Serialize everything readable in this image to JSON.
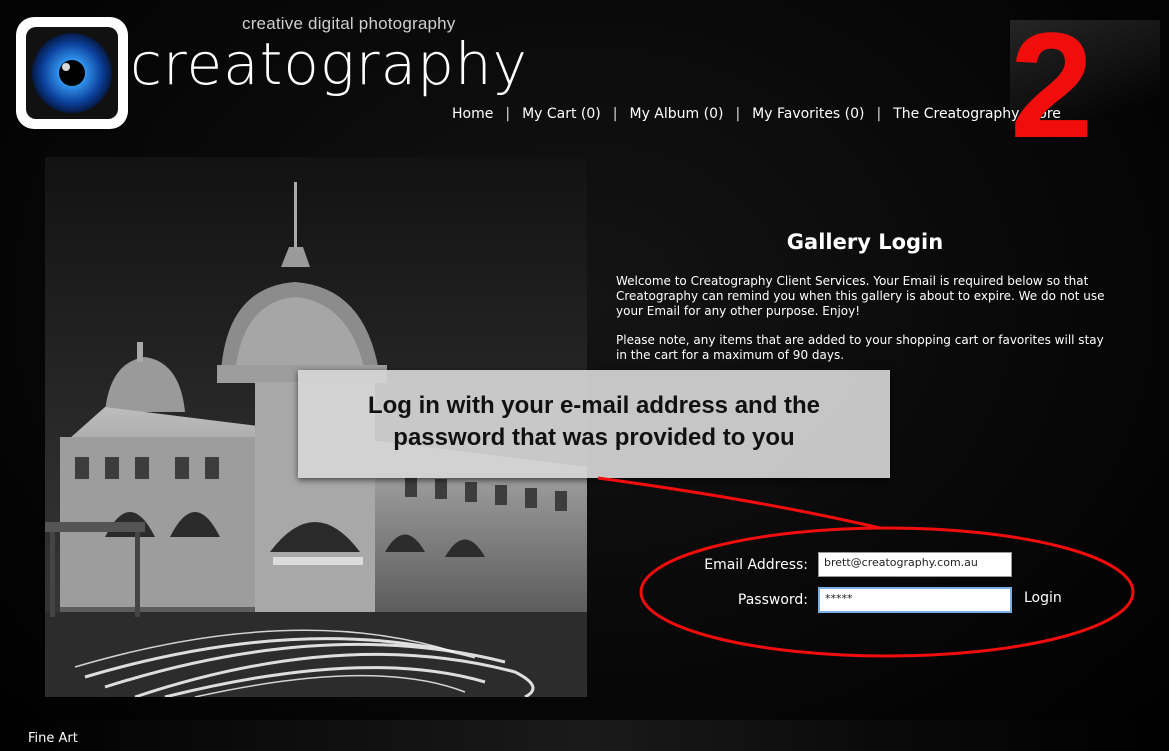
{
  "header": {
    "tagline": "creative digital photography",
    "brand": "creatography",
    "nav": [
      {
        "label": "Home"
      },
      {
        "label": "My Cart (0)"
      },
      {
        "label": "My Album (0)"
      },
      {
        "label": "My Favorites (0)"
      },
      {
        "label": "The Creatography Store"
      }
    ],
    "nav_separator": "|"
  },
  "step_marker": "2",
  "login_panel": {
    "title": "Gallery Login",
    "intro": "Welcome to Creatography Client Services. Your Email is required below so that Creatography can remind you when this gallery is about to expire. We do not use your Email for any other purpose. Enjoy!",
    "note": "Please note, any items that are added to your shopping cart or favorites will stay in the cart for a maximum of 90 days."
  },
  "callout": {
    "line1": "Log in with your e-mail address and the",
    "line2": "password that was provided to you"
  },
  "form": {
    "email_label": "Email Address:",
    "email_value": "brett@creatography.com.au",
    "password_label": "Password:",
    "password_value": "*****",
    "login_label": "Login"
  },
  "footer": {
    "category": "Fine Art"
  },
  "colors": {
    "annotation_red": "#f20d0d",
    "background": "#050505",
    "callout_bg": "#d6d6d6",
    "logo_eye_blue": "#1e7fe0"
  }
}
